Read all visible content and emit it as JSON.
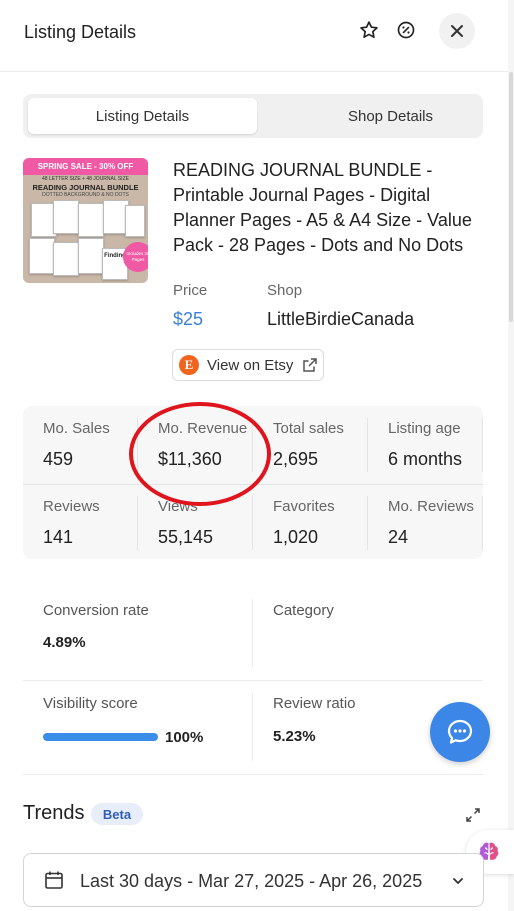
{
  "header": {
    "title": "Listing Details",
    "icons": [
      "star-icon",
      "percent-badge-icon",
      "close-icon"
    ]
  },
  "tabs": [
    {
      "label": "Listing Details",
      "active": true
    },
    {
      "label": "Shop Details",
      "active": false
    }
  ],
  "thumbnail": {
    "banner": "SPRING SALE - 30% OFF",
    "subtitle": "48 LETTER SIZE + 48 JOURNAL SIZE",
    "title": "READING JOURNAL BUNDLE",
    "subtitle2": "DOTTED BACKGROUND & NO DOTS",
    "badge": "Includes 28 Pages",
    "page_label": "Finding"
  },
  "listing": {
    "title": "READING JOURNAL BUNDLE - Printable Journal Pages - Digital Planner Pages - A5 & A4 Size - Value Pack - 28 Pages - Dots and No Dots",
    "price_label": "Price",
    "price": "$25",
    "shop_label": "Shop",
    "shop": "LittleBirdieCanada",
    "etsy_button": "View on Etsy",
    "price_color": "#3a80d6"
  },
  "stats": [
    {
      "label": "Mo. Sales",
      "value": "459"
    },
    {
      "label": "Mo. Revenue",
      "value": "$11,360"
    },
    {
      "label": "Total sales",
      "value": "2,695"
    },
    {
      "label": "Listing age",
      "value": "6 months"
    },
    {
      "label": "Reviews",
      "value": "141"
    },
    {
      "label": "Views",
      "value": "55,145"
    },
    {
      "label": "Favorites",
      "value": "1,020"
    },
    {
      "label": "Mo. Reviews",
      "value": "24"
    }
  ],
  "metrics": {
    "conversion_label": "Conversion rate",
    "conversion_value": "4.89%",
    "category_label": "Category",
    "visibility_label": "Visibility score",
    "visibility_value": "100%",
    "visibility_fraction": 1.0,
    "review_ratio_label": "Review ratio",
    "review_ratio_value": "5.23%"
  },
  "trends": {
    "title": "Trends",
    "badge": "Beta",
    "date_range": "Last 30 days - Mar 27, 2025 - Apr 26, 2025"
  },
  "colors": {
    "accent": "#3b86e6",
    "etsy": "#f1641e",
    "highlight_circle": "#e0141c",
    "sale_pink": "#f05aa5"
  }
}
